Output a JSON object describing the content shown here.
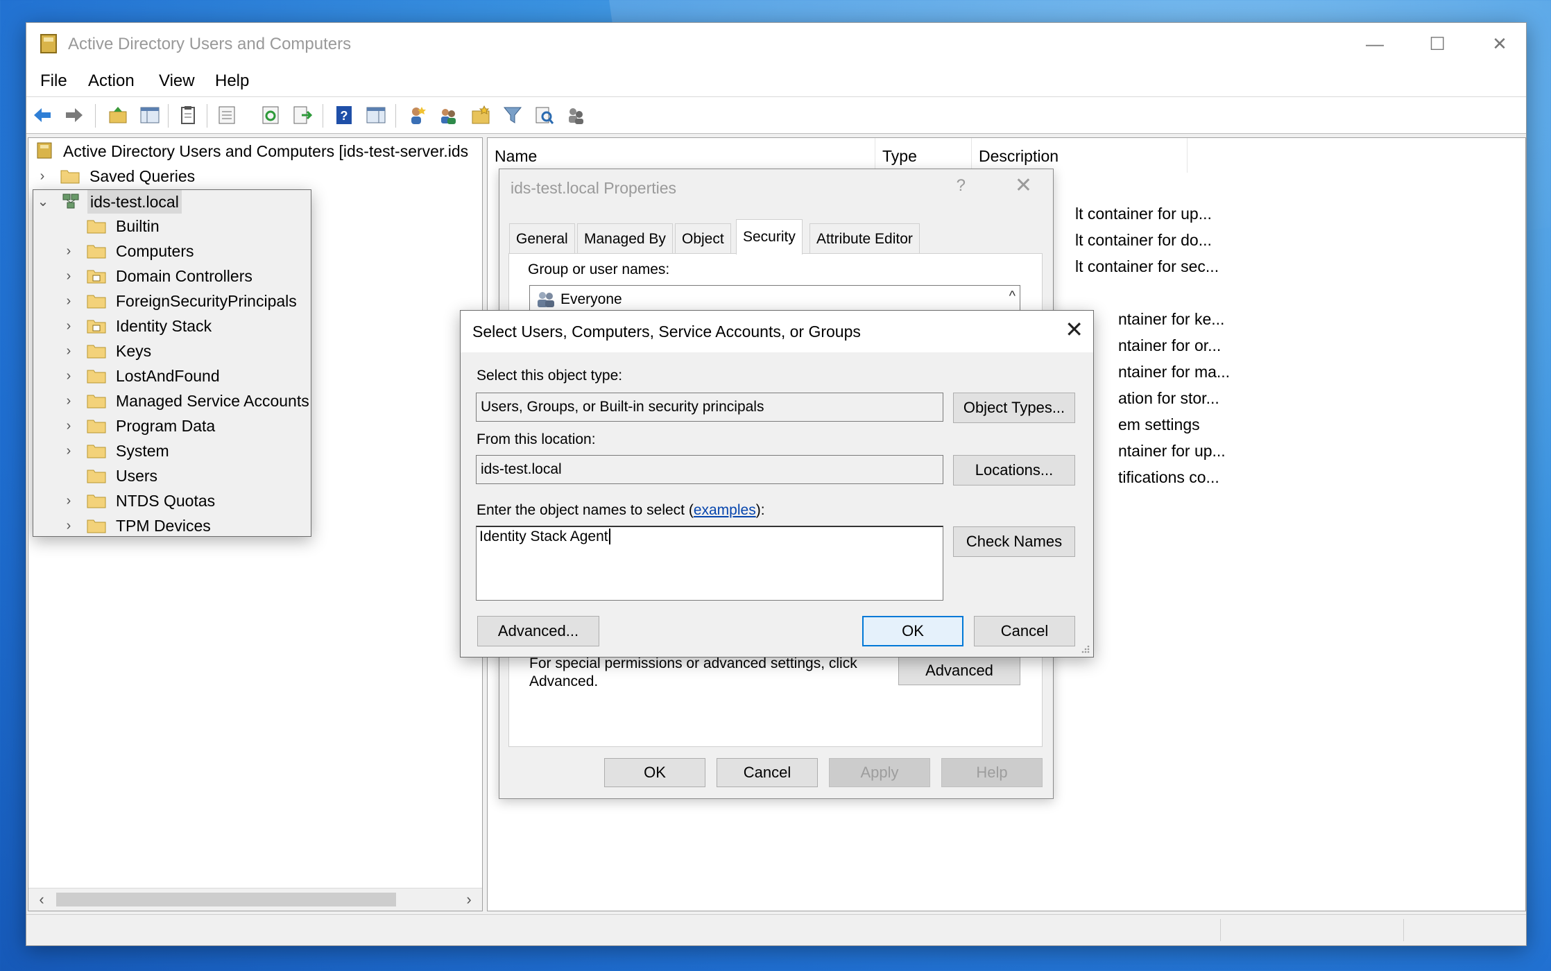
{
  "window": {
    "title": "Active Directory Users and Computers",
    "controls": {
      "minimize": "—",
      "maximize": "☐",
      "close": "✕"
    }
  },
  "menu": [
    "File",
    "Action",
    "View",
    "Help"
  ],
  "toolbar_icons": [
    "back-arrow-icon",
    "forward-arrow-icon",
    "up-folder-icon",
    "show-hide-tree-icon",
    "clipboard-icon",
    "properties-icon",
    "refresh-icon",
    "export-list-icon",
    "help-icon",
    "action-pane-icon",
    "new-user-icon",
    "new-group-icon",
    "new-ou-icon",
    "filter-icon",
    "find-icon",
    "add-to-group-icon"
  ],
  "tree": {
    "root": "Active Directory Users and Computers [ids-test-server.ids",
    "saved_queries": "Saved Queries",
    "domain": "ids-test.local",
    "children": [
      "Builtin",
      "Computers",
      "Domain Controllers",
      "ForeignSecurityPrincipals",
      "Identity Stack",
      "Keys",
      "LostAndFound",
      "Managed Service Accounts",
      "Program Data",
      "System",
      "Users",
      "NTDS Quotas",
      "TPM Devices"
    ],
    "scroll_left": "‹",
    "scroll_right": "›"
  },
  "list": {
    "columns": [
      "Name",
      "Type",
      "Description"
    ],
    "descriptions": [
      "lt container for up...",
      "lt container for do...",
      "lt container for sec...",
      "ntainer for ke...",
      "ntainer for or...",
      "ntainer for ma...",
      "ation for stor...",
      "em settings",
      "ntainer for up...",
      "tifications co..."
    ]
  },
  "properties_dialog": {
    "title": "ids-test.local Properties",
    "help": "?",
    "close": "✕",
    "tabs": [
      "General",
      "Managed By",
      "Object",
      "Security",
      "Attribute Editor"
    ],
    "active_tab": "Security",
    "group_label": "Group or user names:",
    "group_first": "Everyone",
    "scroll_up": "^",
    "advanced_note": "For special permissions or advanced settings, click Advanced.",
    "advanced_button": "Advanced",
    "buttons": {
      "ok": "OK",
      "cancel": "Cancel",
      "apply": "Apply",
      "help": "Help"
    }
  },
  "select_dialog": {
    "title": "Select Users, Computers, Service Accounts, or Groups",
    "close": "✕",
    "object_type_label": "Select this object type:",
    "object_type_value": "Users, Groups, or Built-in security principals",
    "object_types_button": "Object Types...",
    "location_label": "From this location:",
    "location_value": "ids-test.local",
    "locations_button": "Locations...",
    "names_label_prefix": "Enter the object names to select (",
    "names_label_link": "examples",
    "names_label_suffix": "):",
    "names_value": "Identity Stack Agent",
    "check_names_button": "Check Names",
    "advanced_button": "Advanced...",
    "ok_button": "OK",
    "cancel_button": "Cancel"
  }
}
